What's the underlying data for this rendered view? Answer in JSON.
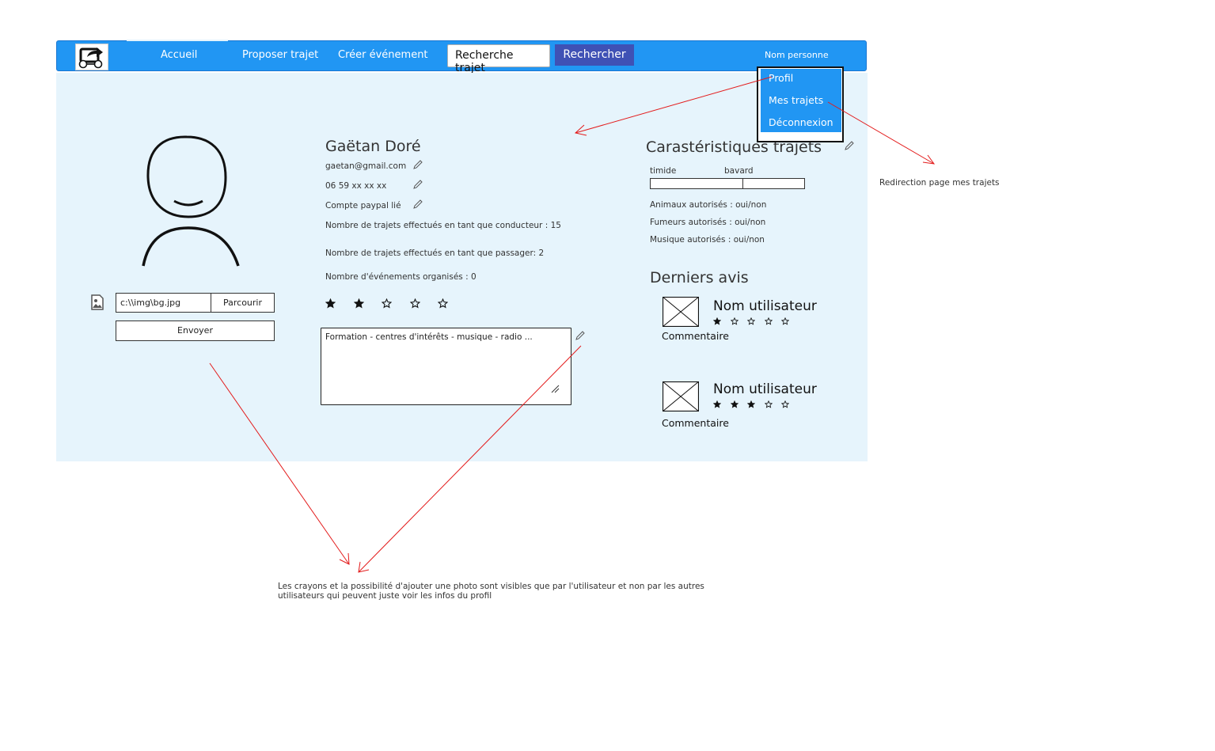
{
  "nav": {
    "items": [
      "Accueil",
      "Proposer trajet",
      "Créer événement"
    ],
    "search_placeholder": "Recherche trajet",
    "search_button": "Rechercher",
    "user_name": "Nom personne",
    "logo_icon": "car-share-icon"
  },
  "dropdown": {
    "items": [
      "Profil",
      "Mes trajets",
      "Déconnexion"
    ]
  },
  "upload": {
    "file_path": "c:\\\\img\\bg.jpg",
    "browse_label": "Parcourir",
    "send_label": "Envoyer"
  },
  "profile": {
    "name": "Gaëtan Doré",
    "email": "gaetan@gmail.com",
    "phone": "06 59 xx xx xx",
    "paypal": "Compte paypal lié",
    "trips_driver": "Nombre de trajets effectués en tant que conducteur : 15",
    "trips_passenger": "Nombre de trajets effectués en tant que passager: 2",
    "events_organized": "Nombre d'événements organisés : 0",
    "rating": 2,
    "rating_max": 5,
    "bio": "Formation - centres d'intérêts - musique - radio ..."
  },
  "characteristics": {
    "title": "Carastéristiques trajets",
    "slider_left": "timide",
    "slider_right": "bavard",
    "animals": "Animaux autorisés : oui/non",
    "smokers": "Fumeurs autorisés : oui/non",
    "music": "Musique autorisés : oui/non"
  },
  "reviews": {
    "title": "Derniers avis",
    "items": [
      {
        "user": "Nom utilisateur",
        "comment": "Commentaire",
        "rating": 1
      },
      {
        "user": "Nom utilisateur",
        "comment": "Commentaire",
        "rating": 3
      }
    ]
  },
  "annotations": {
    "mes_trajets_note": "Redirection page mes trajets",
    "pencil_note_line1": "Les crayons et la possibilité d'ajouter une photo sont visibles que par l'utilisateur et non par les autres",
    "pencil_note_line2": "utilisateurs qui peuvent juste voir les infos du profil",
    "arrow_color": "#e31b1b"
  },
  "colors": {
    "nav_blue": "#2196f3",
    "button_indigo": "#3f51b5",
    "panel_bg": "#e6f4fc"
  }
}
